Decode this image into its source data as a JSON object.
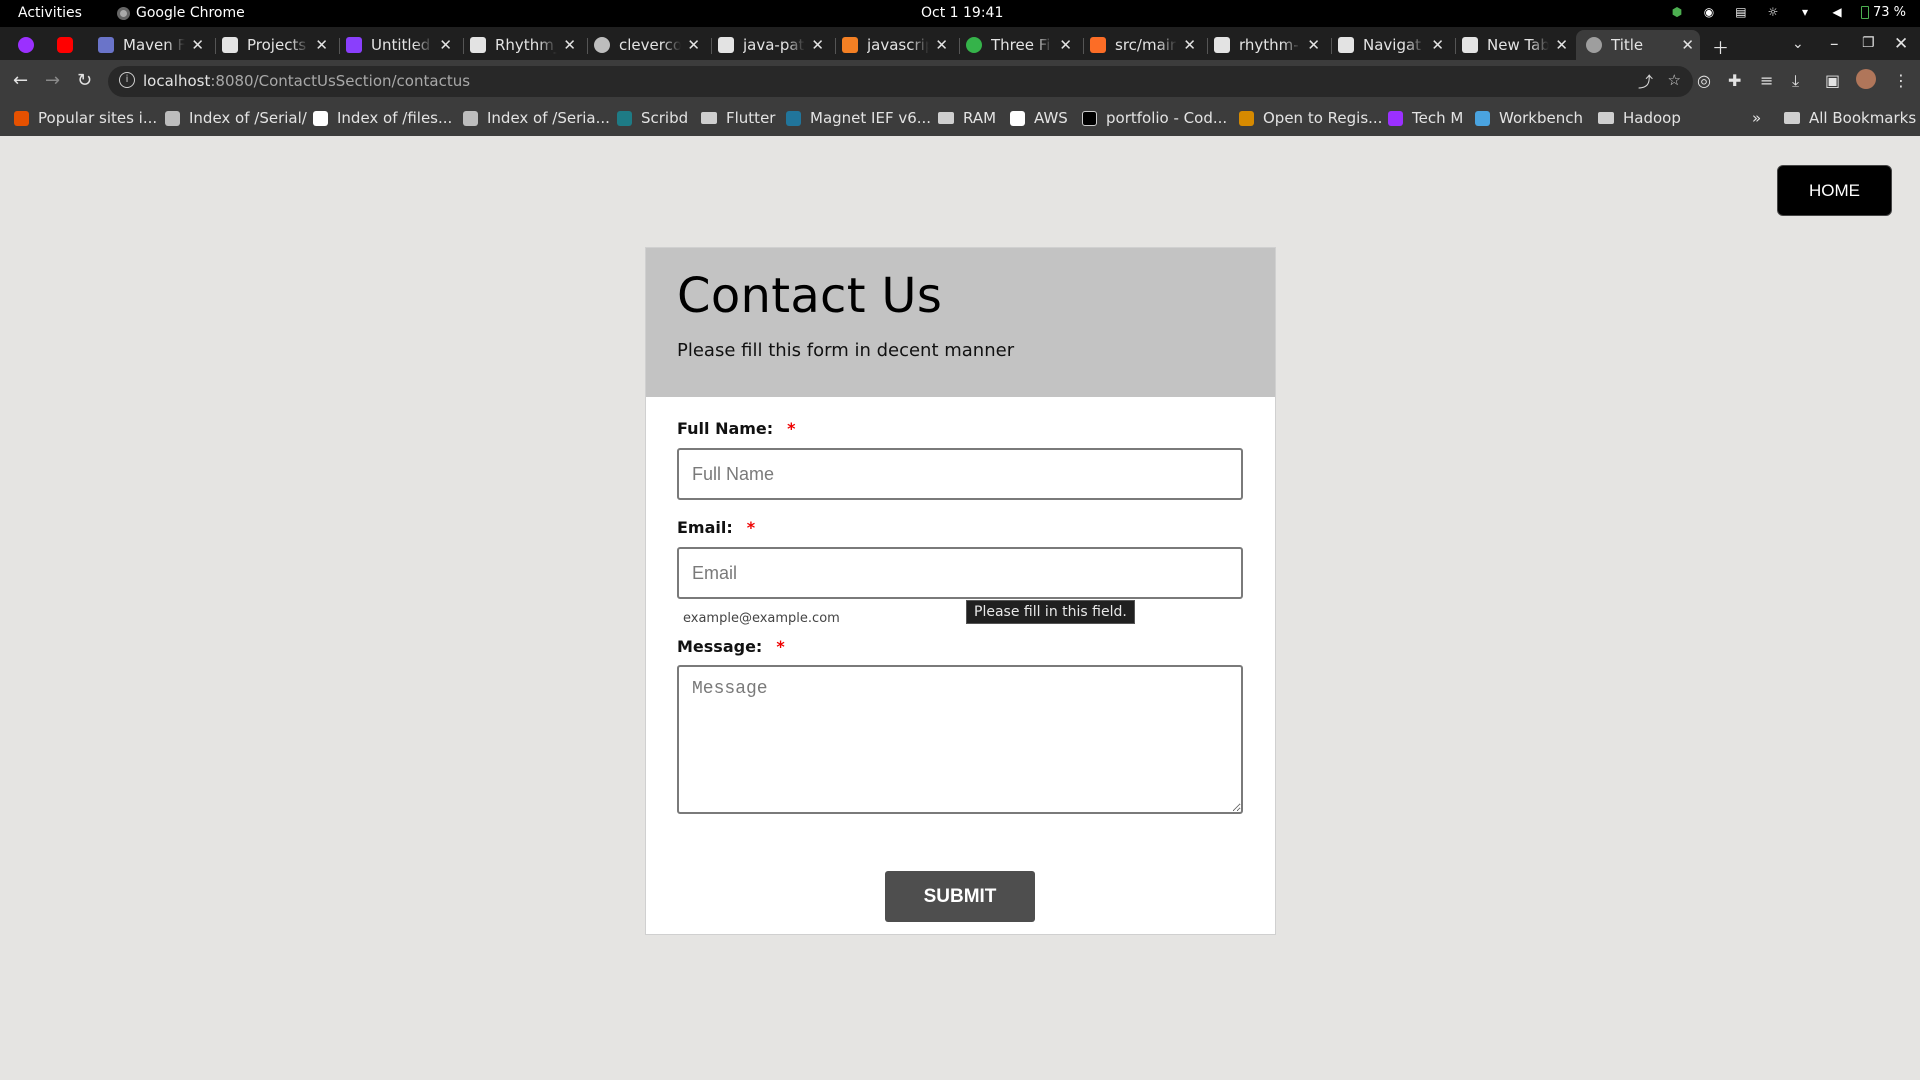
{
  "os_bar": {
    "activities": "Activities",
    "app_name": "Google Chrome",
    "clock": "Oct 1  19:41",
    "battery": "73 %"
  },
  "tabs": [
    {
      "title": "",
      "favicon_color": "#9b30ff"
    },
    {
      "title": "",
      "favicon_color": "#ff0000"
    },
    {
      "title": "Maven F",
      "favicon_color": "#6a74c9"
    },
    {
      "title": "Projects",
      "favicon_color": "#e3e3e3"
    },
    {
      "title": "Untitled",
      "favicon_color": "#8a3ffc"
    },
    {
      "title": "Rhythm_",
      "favicon_color": "#e3e3e3"
    },
    {
      "title": "cleverco",
      "favicon_color": "#bdbdbd"
    },
    {
      "title": "java-pat",
      "favicon_color": "#e3e3e3"
    },
    {
      "title": "javascrip",
      "favicon_color": "#f48024"
    },
    {
      "title": "Three Fi",
      "favicon_color": "#35b34a"
    },
    {
      "title": "src/mair",
      "favicon_color": "#fc6d26"
    },
    {
      "title": "rhythm-",
      "favicon_color": "#e3e3e3"
    },
    {
      "title": "Navigat",
      "favicon_color": "#e3e3e3"
    },
    {
      "title": "New Tab",
      "favicon_color": "#e3e3e3"
    },
    {
      "title": "Title",
      "favicon_color": "#9e9e9e"
    }
  ],
  "address_bar": {
    "host": "localhost",
    "path": ":8080/ContactUsSection/contactus"
  },
  "bookmarks": [
    {
      "label": "Popular sites i...",
      "icon": "#e65100",
      "folder": false
    },
    {
      "label": "Index of /Serial/",
      "icon": "#bdbdbd",
      "folder": false
    },
    {
      "label": "Index of /files...",
      "icon": "#ffffff",
      "folder": false
    },
    {
      "label": "Index of /Seria...",
      "icon": "#bdbdbd",
      "folder": false
    },
    {
      "label": "Scribd",
      "icon": "#1e7b85",
      "folder": false
    },
    {
      "label": "Flutter",
      "icon": "",
      "folder": true
    },
    {
      "label": "Magnet IEF v6...",
      "icon": "#21759b",
      "folder": false
    },
    {
      "label": "RAM",
      "icon": "",
      "folder": true
    },
    {
      "label": "AWS",
      "icon": "#ffffff",
      "folder": false
    },
    {
      "label": "portfolio - Cod...",
      "icon": "#000000",
      "folder": false
    },
    {
      "label": "Open to Regis...",
      "icon": "#d68a00",
      "folder": false
    },
    {
      "label": "Tech M",
      "icon": "#9b30ff",
      "folder": false
    },
    {
      "label": "Workbench",
      "icon": "#4aa3df",
      "folder": false
    },
    {
      "label": "Hadoop",
      "icon": "",
      "folder": true
    }
  ],
  "all_bookmarks": "All Bookmarks",
  "page": {
    "home_button": "HOME",
    "title": "Contact Us",
    "subtitle": "Please fill this form in decent manner",
    "fields": {
      "name_label": "Full Name:",
      "name_placeholder": "Full Name",
      "email_label": "Email:",
      "email_placeholder": "Email",
      "email_hint": "example@example.com",
      "message_label": "Message:",
      "message_placeholder": "Message",
      "required_mark": "*"
    },
    "validation_tooltip": "Please fill in this field.",
    "submit_button": "SUBMIT"
  }
}
